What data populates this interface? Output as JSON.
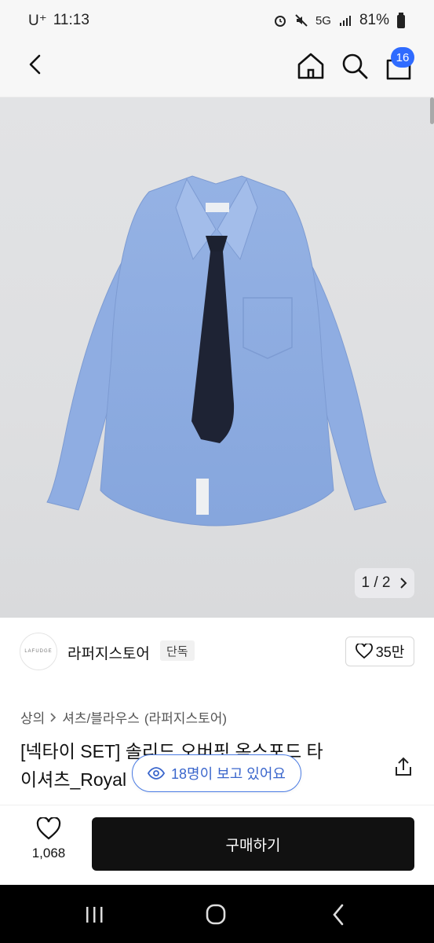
{
  "status_bar": {
    "carrier": "U⁺",
    "time": "11:13",
    "network": "5G",
    "battery": "81%",
    "icons": [
      "alarm-icon",
      "mute-icon",
      "5g-icon",
      "signal-icon",
      "battery-icon"
    ]
  },
  "header": {
    "icons": [
      "back-icon",
      "home-icon",
      "search-icon",
      "cart-icon"
    ],
    "cart_count": "16"
  },
  "gallery": {
    "current": "1",
    "total": "2",
    "separator": "/",
    "image_description_icon": "shirt-with-tie-photo"
  },
  "store": {
    "logo_text": "LAFUDGE",
    "name": "라퍼지스토어",
    "badge": "단독",
    "likes": "35만"
  },
  "breadcrumb": {
    "items": [
      "상의",
      "셔츠/블라우스",
      "(라퍼지스토어)"
    ]
  },
  "product": {
    "title_line1": "[넥타이 SET] 솔리드 오버핏 옥스포드 타",
    "title_line2": "이셔츠_Royal"
  },
  "viewers": {
    "text": "18명이 보고 있어요"
  },
  "buy_bar": {
    "wish_count": "1,068",
    "purchase_label": "구매하기"
  },
  "colors": {
    "accent": "#2f6bff",
    "viewer_pill": "#3a66cc",
    "purchase_button": "#111111"
  }
}
